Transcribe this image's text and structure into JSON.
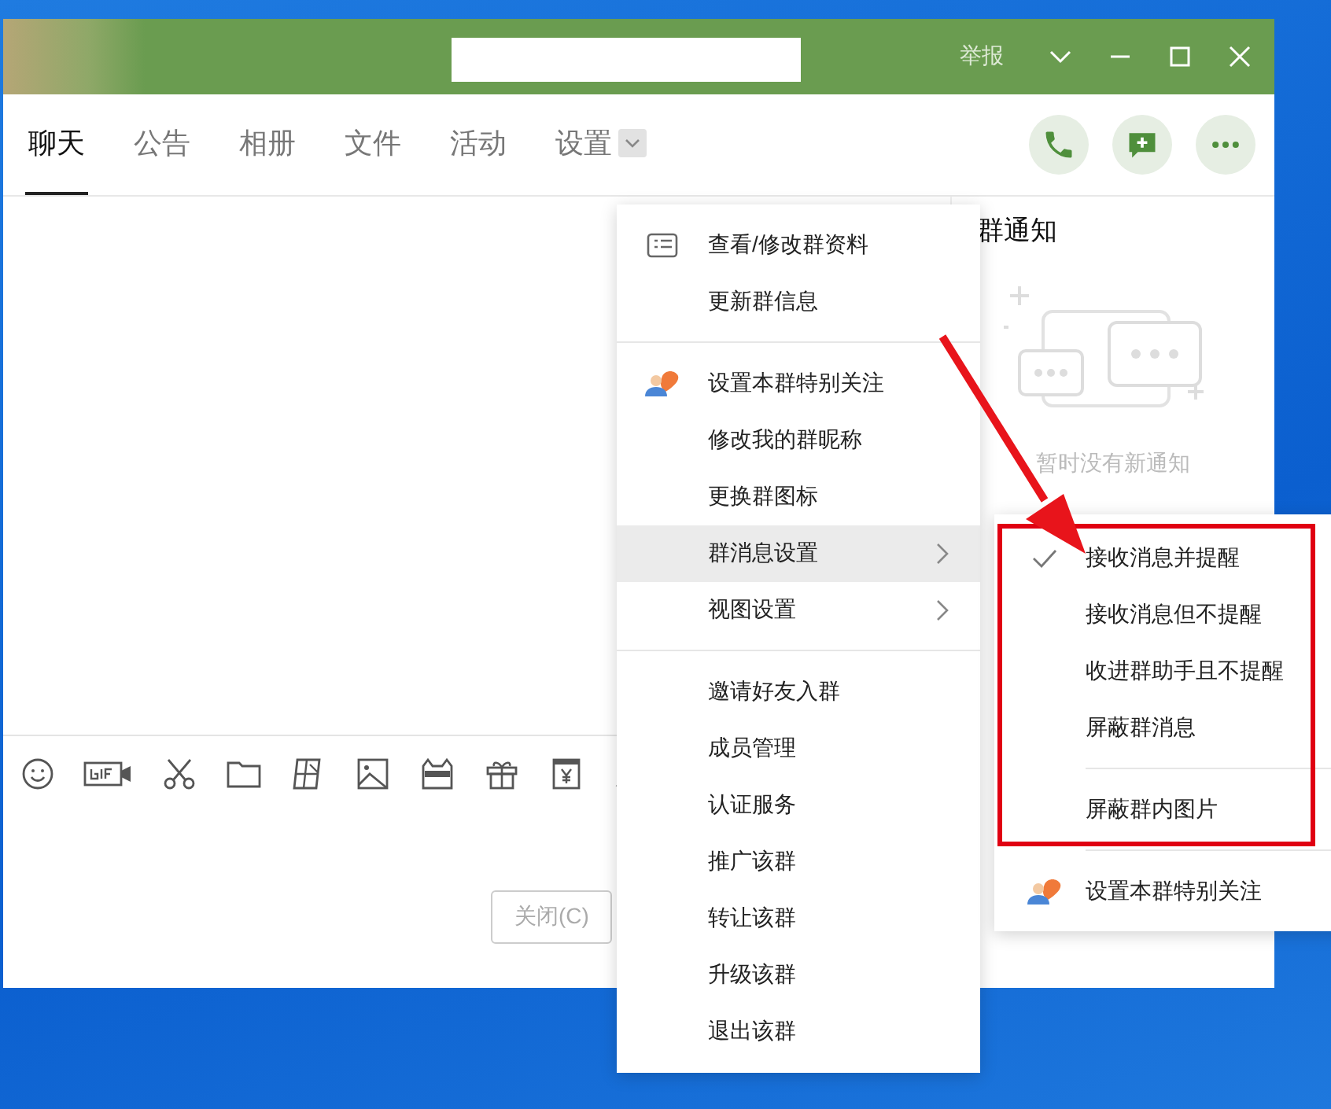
{
  "window": {
    "report": "举报"
  },
  "tabs": [
    {
      "label": "聊天",
      "selected": true,
      "dropdown": false
    },
    {
      "label": "公告",
      "selected": false,
      "dropdown": false
    },
    {
      "label": "相册",
      "selected": false,
      "dropdown": false
    },
    {
      "label": "文件",
      "selected": false,
      "dropdown": false
    },
    {
      "label": "活动",
      "selected": false,
      "dropdown": false
    },
    {
      "label": "设置",
      "selected": false,
      "dropdown": true
    }
  ],
  "notice_panel": {
    "title": "群通知",
    "empty_text": "暂时没有新通知"
  },
  "close_button": "关闭(C)",
  "context_menu": {
    "groups": [
      [
        {
          "label": "查看/修改群资料",
          "kind": "card",
          "submenu": false,
          "selected": false
        },
        {
          "label": "更新群信息",
          "kind": "plain",
          "submenu": false,
          "selected": false
        }
      ],
      [
        {
          "label": "设置本群特别关注",
          "kind": "heart",
          "submenu": false,
          "selected": false
        },
        {
          "label": "修改我的群昵称",
          "kind": "plain",
          "submenu": false,
          "selected": false
        },
        {
          "label": "更换群图标",
          "kind": "plain",
          "submenu": false,
          "selected": false
        },
        {
          "label": "群消息设置",
          "kind": "plain",
          "submenu": true,
          "selected": true
        },
        {
          "label": "视图设置",
          "kind": "plain",
          "submenu": true,
          "selected": false
        }
      ],
      [
        {
          "label": "邀请好友入群",
          "kind": "plain",
          "submenu": false,
          "selected": false
        },
        {
          "label": "成员管理",
          "kind": "plain",
          "submenu": false,
          "selected": false
        },
        {
          "label": "认证服务",
          "kind": "plain",
          "submenu": false,
          "selected": false
        },
        {
          "label": "推广该群",
          "kind": "plain",
          "submenu": false,
          "selected": false
        },
        {
          "label": "转让该群",
          "kind": "plain",
          "submenu": false,
          "selected": false
        },
        {
          "label": "升级该群",
          "kind": "plain",
          "submenu": false,
          "selected": false
        },
        {
          "label": "退出该群",
          "kind": "plain",
          "submenu": false,
          "selected": false
        }
      ]
    ]
  },
  "submenu": {
    "groups": [
      [
        {
          "label": "接收消息并提醒",
          "kind": "plain",
          "checked": true
        },
        {
          "label": "接收消息但不提醒",
          "kind": "plain",
          "checked": false
        },
        {
          "label": "收进群助手且不提醒",
          "kind": "plain",
          "checked": false
        },
        {
          "label": "屏蔽群消息",
          "kind": "plain",
          "checked": false
        }
      ],
      [
        {
          "label": "屏蔽群内图片",
          "kind": "plain",
          "checked": false
        }
      ],
      [
        {
          "label": "设置本群特别关注",
          "kind": "heart",
          "checked": false
        }
      ]
    ]
  }
}
